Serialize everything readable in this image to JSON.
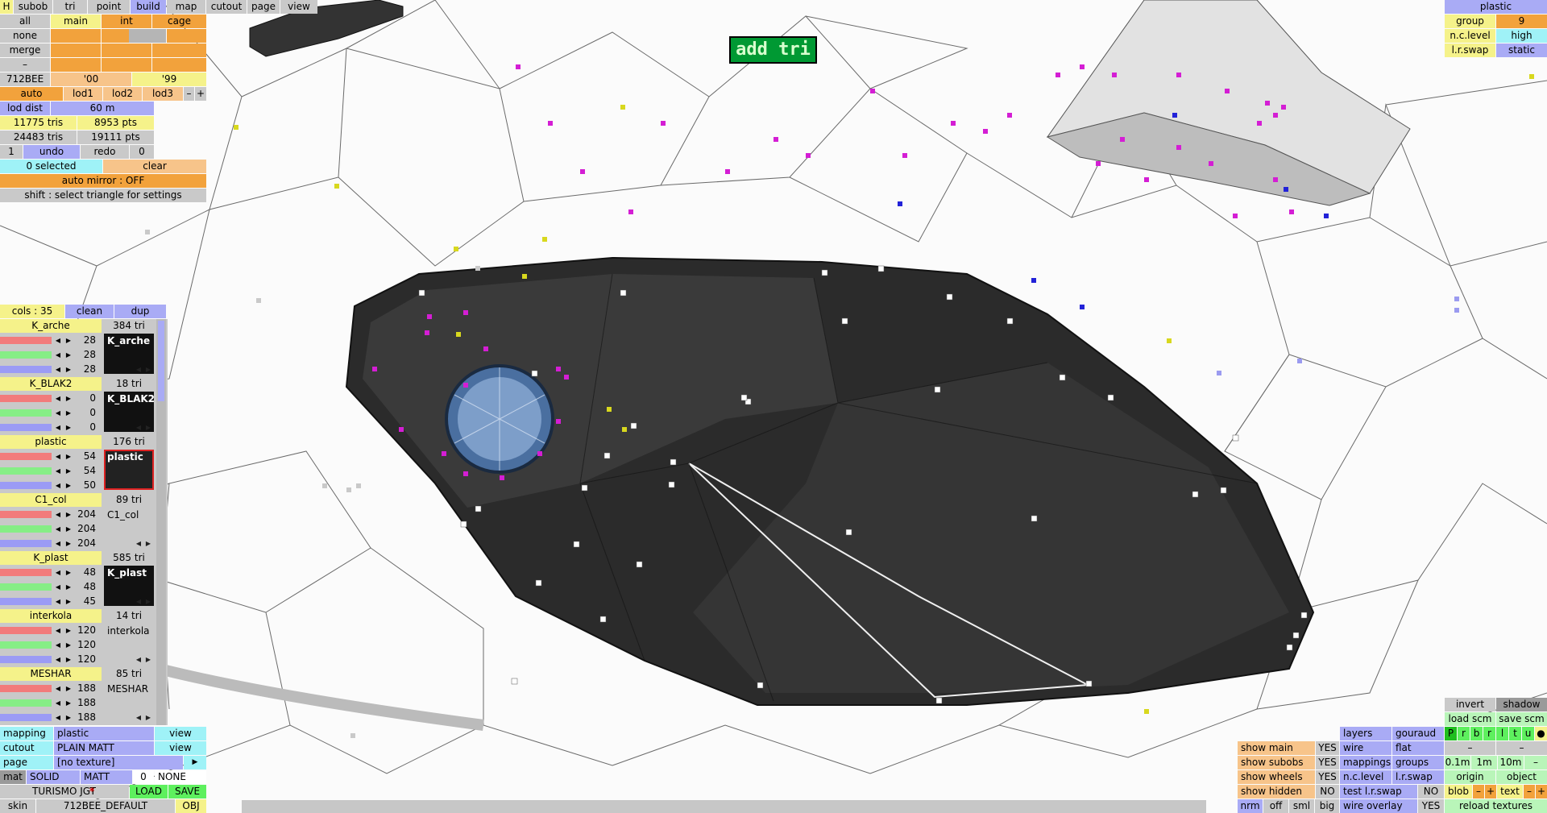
{
  "mode_tabs": [
    "H",
    "subob",
    "tri",
    "point",
    "build",
    "map",
    "cutout",
    "page",
    "view"
  ],
  "active_tab": "build",
  "select_rows": [
    {
      "label": "all",
      "cols": [
        "main",
        "int",
        "cage"
      ]
    },
    {
      "label": "none",
      "cols": [
        "",
        "",
        ""
      ]
    },
    {
      "label": "merge",
      "cols": [
        "",
        "",
        ""
      ]
    },
    {
      "label": "–",
      "cols": [
        "",
        "",
        ""
      ]
    }
  ],
  "car_row": {
    "code": "712BEE",
    "y1": "'00",
    "y2": "'99"
  },
  "lod": {
    "auto": "auto",
    "lod1": "lod1",
    "lod2": "lod2",
    "lod3": "lod3",
    "minus": "–",
    "plus": "+"
  },
  "lod_dist": {
    "label": "lod dist",
    "value": "60 m"
  },
  "stats": {
    "tris1": "11775 tris",
    "pts1": "8953 pts",
    "tris2": "24483 tris",
    "pts2": "19111 pts"
  },
  "undo_row": {
    "left": "1",
    "undo": "undo",
    "redo": "redo",
    "right": "0"
  },
  "selection": {
    "selected": "0 selected",
    "clear": "clear"
  },
  "auto_mirror": "auto mirror : OFF",
  "hint": "shift : select triangle for settings",
  "cols_header": {
    "cols": "cols : 35",
    "clean": "clean",
    "dup": "dup"
  },
  "materials": [
    {
      "name": "K_arche",
      "tris": "384 tri",
      "rgb": [
        "28",
        "28",
        "28"
      ],
      "swatch": "K_arche",
      "style": "dark",
      "colors": [
        "#f27b7b",
        "#86ee86",
        "#9b9bf5"
      ]
    },
    {
      "name": "K_BLAK2",
      "tris": "18 tri",
      "rgb": [
        "0",
        "0",
        "0"
      ],
      "swatch": "K_BLAK2",
      "style": "dark",
      "colors": [
        "#f27b7b",
        "#86ee86",
        "#9b9bf5"
      ]
    },
    {
      "name": "plastic",
      "tris": "176 tri",
      "rgb": [
        "54",
        "54",
        "50"
      ],
      "swatch": "plastic",
      "style": "sel",
      "colors": [
        "#f27b7b",
        "#86ee86",
        "#9b9bf5"
      ]
    },
    {
      "name": "C1_col",
      "tris": "89 tri",
      "rgb": [
        "204",
        "204",
        "204"
      ],
      "swatch": "C1_col",
      "style": "plain",
      "colors": [
        "#f27b7b",
        "#86ee86",
        "#9b9bf5"
      ]
    },
    {
      "name": "K_plast",
      "tris": "585 tri",
      "rgb": [
        "48",
        "48",
        "45"
      ],
      "swatch": "K_plast",
      "style": "dark",
      "colors": [
        "#f27b7b",
        "#86ee86",
        "#9b9bf5"
      ]
    },
    {
      "name": "interkola",
      "tris": "14 tri",
      "rgb": [
        "120",
        "120",
        "120"
      ],
      "swatch": "interkola",
      "style": "plain",
      "colors": [
        "#f27b7b",
        "#86ee86",
        "#9b9bf5"
      ]
    },
    {
      "name": "MESHAR",
      "tris": "85 tri",
      "rgb": [
        "188",
        "188",
        "188"
      ],
      "swatch": "MESHAR",
      "style": "plain",
      "colors": [
        "#f27b7b",
        "#86ee86",
        "#9b9bf5"
      ]
    }
  ],
  "bottom_left": {
    "mapping": {
      "label": "mapping",
      "value": "plastic",
      "btn": "view"
    },
    "cutout": {
      "label": "cutout",
      "value": "PLAIN MATT",
      "btn": "view"
    },
    "page": {
      "label": "page",
      "value": "[no texture]",
      "btn": "▶"
    },
    "mat": {
      "label": "mat",
      "v1": "SOLID",
      "v2": "MATT",
      "v3": "0",
      "v4": "NONE"
    },
    "turismo": {
      "label": "TURISMO JGT",
      "star": "*",
      "load": "LOAD",
      "save": "SAVE"
    },
    "skin": {
      "label": "skin",
      "value": "712BEE_DEFAULT",
      "obj": "OBJ"
    }
  },
  "top_right": {
    "title": "plastic",
    "group": {
      "label": "group",
      "value": "9"
    },
    "nclevel": {
      "label": "n.c.level",
      "value": "high"
    },
    "lrswap": {
      "label": "l.r.swap",
      "value": "static"
    }
  },
  "add_tri": "add tri",
  "bottom_right": {
    "show": [
      {
        "label": "show main",
        "value": "YES"
      },
      {
        "label": "show subobs",
        "value": "YES"
      },
      {
        "label": "show wheels",
        "value": "YES"
      },
      {
        "label": "show hidden",
        "value": "NO"
      }
    ],
    "view_modes": [
      [
        "layers",
        "gouraud"
      ],
      [
        "wire",
        "flat"
      ],
      [
        "mappings",
        "groups"
      ],
      [
        "n.c.level",
        "l.r.swap"
      ]
    ],
    "test_lr": {
      "label": "test l.r.swap",
      "value": "NO"
    },
    "wire_overlay": {
      "label": "wire overlay",
      "value": "YES"
    },
    "nrm_row": [
      "nrm",
      "off",
      "sml",
      "big"
    ],
    "invert": "invert",
    "shadow": "shadow",
    "load_scm": "load scm",
    "save_scm": "save scm",
    "prbrltu": [
      "P",
      "r",
      "b",
      "r",
      "l",
      "t",
      "u",
      "●"
    ],
    "dash_row": [
      "–",
      "–"
    ],
    "scale_row": [
      "0.1m",
      "1m",
      "10m",
      "–"
    ],
    "origin": "origin",
    "object": "object",
    "blob_row": [
      "blob",
      "–",
      "+",
      "text",
      "–",
      "+"
    ],
    "reload": "reload textures"
  }
}
